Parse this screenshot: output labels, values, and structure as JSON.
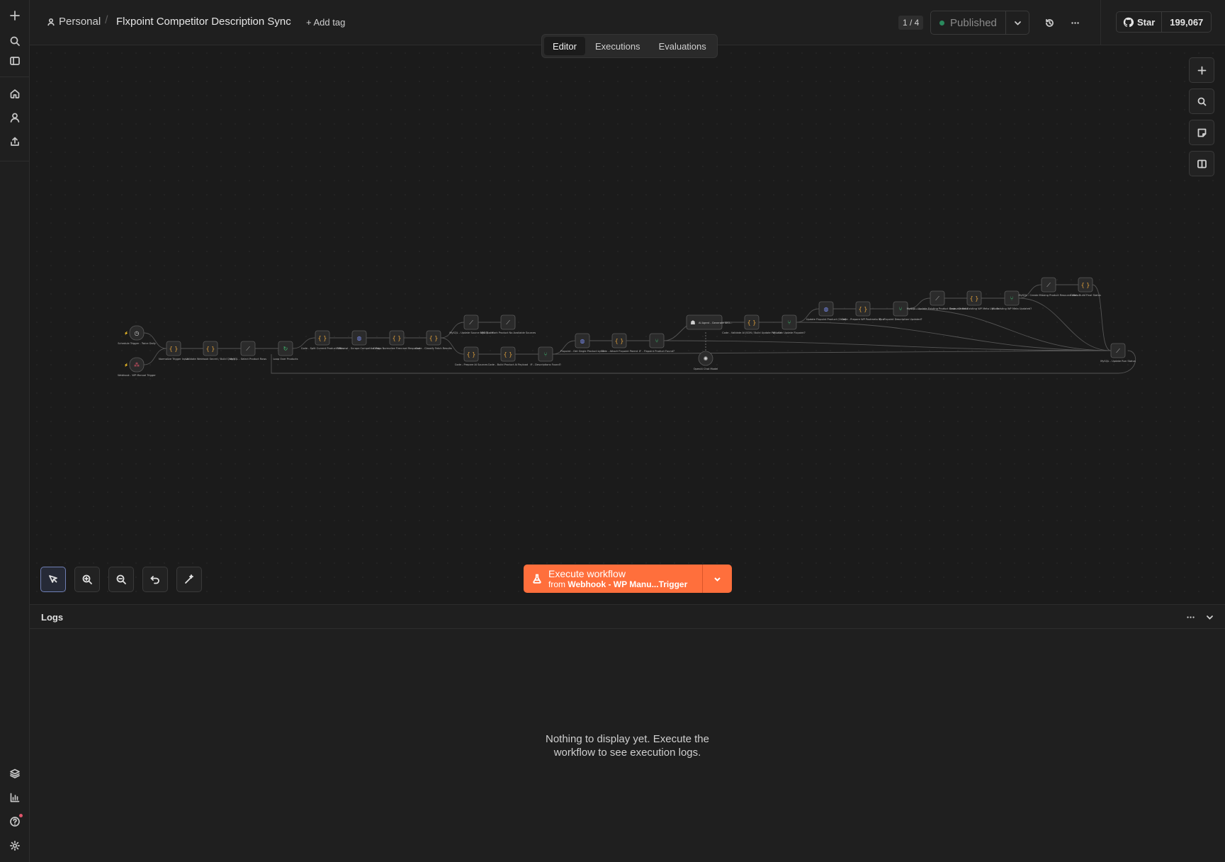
{
  "header": {
    "project": "Personal",
    "workflow_name": "Flxpoint Competitor Description Sync",
    "add_tag": "+ Add tag",
    "version": "1 / 4",
    "status": "Published",
    "github_star": "Star",
    "github_count": "199,067"
  },
  "tabs": [
    {
      "label": "Editor",
      "active": true
    },
    {
      "label": "Executions",
      "active": false
    },
    {
      "label": "Evaluations",
      "active": false
    }
  ],
  "execute": {
    "title": "Execute workflow",
    "from_prefix": "from",
    "trigger": "Webhook - WP Manu...Trigger"
  },
  "logs": {
    "title": "Logs",
    "empty_line1": "Nothing to display yet. Execute the",
    "empty_line2": "workflow to see execution logs."
  },
  "colors": {
    "accent_orange": "#ff6f3c",
    "published_dot": "#2a8a5e",
    "node_code": "#e3a23c",
    "node_if": "#3fb96f",
    "node_http": "#7a8cf0",
    "node_mysql": "#bcbcbc"
  },
  "nodes": [
    {
      "id": "n1",
      "icon": "clock",
      "label": "Schedule Trigger - Twice Daily"
    },
    {
      "id": "n2",
      "icon": "webhook",
      "label": "Webhook - WP Manual Trigger"
    },
    {
      "id": "n3",
      "icon": "code",
      "label": "Normalize Trigger Input"
    },
    {
      "id": "n4",
      "icon": "code",
      "label": "Validate Webhook Secret / Build Query"
    },
    {
      "id": "n5",
      "icon": "mysql",
      "label": "MySQL - Select Product Rows"
    },
    {
      "id": "n6",
      "icon": "loop",
      "label": "Loop Over Products"
    },
    {
      "id": "n7",
      "icon": "code",
      "label": "Code - Split Current Product URLs"
    },
    {
      "id": "n8",
      "icon": "http",
      "label": "Firecrawl - Scrape Competitor Page"
    },
    {
      "id": "n9",
      "icon": "code",
      "label": "Code - Normalize Firecrawl Response"
    },
    {
      "id": "n10",
      "icon": "code",
      "label": "Code - Classify Fetch Results"
    },
    {
      "id": "n11",
      "icon": "mysql",
      "label": "MySQL - Update Source URL State"
    },
    {
      "id": "n12",
      "icon": "mysql",
      "label": "MySQL - Mark Product No Available Sources"
    },
    {
      "id": "n13",
      "icon": "code",
      "label": "Code - Prepare AI Sources"
    },
    {
      "id": "n14",
      "icon": "code",
      "label": "Code - Build Product AI Payload"
    },
    {
      "id": "n15",
      "icon": "if",
      "label": "IF - Descriptions Found?"
    },
    {
      "id": "n16",
      "icon": "http",
      "label": "Flxpoint - Get Single Product by ID"
    },
    {
      "id": "n17",
      "icon": "code",
      "label": "Code - Attach Flxpoint Parent"
    },
    {
      "id": "n18",
      "icon": "if",
      "label": "IF - Flxpoint Product Found?"
    },
    {
      "id": "n19",
      "icon": "ai",
      "label": "AI Agent - Generate SEO..."
    },
    {
      "id": "n20",
      "icon": "openai",
      "label": "OpenAI Chat Model"
    },
    {
      "id": "n21",
      "icon": "code",
      "label": "Code - Validate AI JSON / Build Update Payload"
    },
    {
      "id": "n22",
      "icon": "if",
      "label": "IF - Can Update Flxpoint?"
    },
    {
      "id": "n23",
      "icon": "http",
      "label": "Update Flxpoint Product (Child)"
    },
    {
      "id": "n24",
      "icon": "code",
      "label": "Code - Prepare WP Postmeta Sync"
    },
    {
      "id": "n25",
      "icon": "if",
      "label": "IF - Flxpoint Description Updated?"
    },
    {
      "id": "n26",
      "icon": "mysql",
      "label": "MySQL - Update Existing Product Resource Meta"
    },
    {
      "id": "n27",
      "icon": "code",
      "label": "Code - Check Existing WP Meta Update"
    },
    {
      "id": "n28",
      "icon": "if",
      "label": "IF - Existing WP Meta Updated?"
    },
    {
      "id": "n29",
      "icon": "mysql",
      "label": "MySQL - Create Missing Product Resource Meta"
    },
    {
      "id": "n30",
      "icon": "code",
      "label": "Code - Build Final Status"
    },
    {
      "id": "n31",
      "icon": "mysql",
      "label": "MySQL - Update Run Status"
    }
  ]
}
